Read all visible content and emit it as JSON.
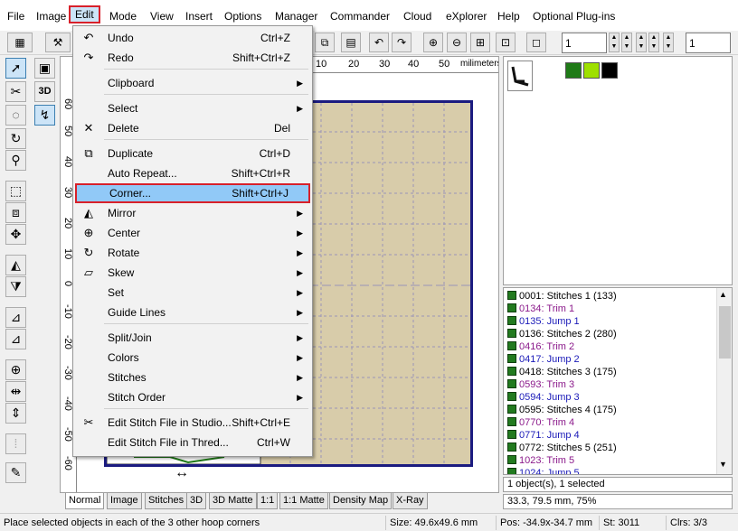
{
  "menubar": {
    "items": [
      "File",
      "Image",
      "Edit",
      "Mode",
      "View",
      "Insert",
      "Options",
      "Manager",
      "Commander",
      "Cloud",
      "eXplorer",
      "Help",
      "Optional Plug-ins"
    ]
  },
  "toolbar": {
    "field1_value": "1",
    "field2_value": "1"
  },
  "ruler": {
    "h_ticks": [
      "10",
      "20",
      "30",
      "40",
      "50"
    ],
    "h_unit": "milimeters",
    "v_ticks": [
      "60",
      "50",
      "40",
      "30",
      "20",
      "10",
      "0",
      "-10",
      "-20",
      "-30",
      "-40",
      "-50",
      "-60"
    ]
  },
  "edit_menu": {
    "items": [
      {
        "label": "Undo",
        "shortcut": "Ctrl+Z",
        "icon": "undo-icon",
        "glyph": "↶"
      },
      {
        "label": "Redo",
        "shortcut": "Shift+Ctrl+Z",
        "icon": "redo-icon",
        "glyph": "↷"
      },
      {
        "label": "Clipboard",
        "submenu": true
      },
      {
        "label": "Select",
        "submenu": true
      },
      {
        "label": "Delete",
        "shortcut": "Del",
        "icon": "delete-icon",
        "glyph": "✕"
      },
      {
        "label": "Duplicate",
        "shortcut": "Ctrl+D",
        "icon": "duplicate-icon",
        "glyph": "⧉"
      },
      {
        "label": "Auto Repeat...",
        "shortcut": "Shift+Ctrl+R"
      },
      {
        "label": "Corner...",
        "shortcut": "Shift+Ctrl+J",
        "highlighted": true
      },
      {
        "label": "Mirror",
        "submenu": true,
        "icon": "mirror-icon",
        "glyph": "◭"
      },
      {
        "label": "Center",
        "submenu": true,
        "icon": "center-icon",
        "glyph": "⊕"
      },
      {
        "label": "Rotate",
        "submenu": true,
        "icon": "rotate-icon",
        "glyph": "↻"
      },
      {
        "label": "Skew",
        "submenu": true,
        "icon": "skew-icon",
        "glyph": "▱"
      },
      {
        "label": "Set",
        "submenu": true
      },
      {
        "label": "Guide Lines",
        "submenu": true
      },
      {
        "label": "Split/Join",
        "submenu": true
      },
      {
        "label": "Colors",
        "submenu": true
      },
      {
        "label": "Stitches",
        "submenu": true
      },
      {
        "label": "Stitch Order",
        "submenu": true
      },
      {
        "label": "Edit Stitch File in Studio...",
        "shortcut": "Shift+Ctrl+E",
        "icon": "studio-icon",
        "glyph": "✂"
      },
      {
        "label": "Edit Stitch File in Thred...",
        "shortcut": "Ctrl+W"
      }
    ]
  },
  "colors": {
    "swatch1": "#1f7a17",
    "swatch2": "#9ee000",
    "swatch3": "#000000"
  },
  "object_list": [
    {
      "text": "0001:  Stitches 1 (133)",
      "color": "#000000"
    },
    {
      "text": "0134:  Trim 1",
      "color": "#8b1a8b"
    },
    {
      "text": "0135:  Jump 1",
      "color": "#1a1ab8"
    },
    {
      "text": "0136:  Stitches 2 (280)",
      "color": "#000000"
    },
    {
      "text": "0416:  Trim 2",
      "color": "#8b1a8b"
    },
    {
      "text": "0417:  Jump 2",
      "color": "#1a1ab8"
    },
    {
      "text": "0418:  Stitches 3 (175)",
      "color": "#000000"
    },
    {
      "text": "0593:  Trim 3",
      "color": "#8b1a8b"
    },
    {
      "text": "0594:  Jump 3",
      "color": "#1a1ab8"
    },
    {
      "text": "0595:  Stitches 4 (175)",
      "color": "#000000"
    },
    {
      "text": "0770:  Trim 4",
      "color": "#8b1a8b"
    },
    {
      "text": "0771:  Jump 4",
      "color": "#1a1ab8"
    },
    {
      "text": "0772:  Stitches 5 (251)",
      "color": "#000000"
    },
    {
      "text": "1023:  Trim 5",
      "color": "#8b1a8b"
    },
    {
      "text": "1024:  Jump 5",
      "color": "#1a1ab8"
    }
  ],
  "info": {
    "selection": "1 object(s), 1 selected",
    "coords": "33.3, 79.5 mm, 75%"
  },
  "tabs": [
    "Normal",
    "Image",
    "Stitches",
    "3D",
    "3D Matte",
    "1:1",
    "1:1 Matte",
    "Density Map",
    "X-Ray"
  ],
  "status": {
    "message": "Place selected objects in each of the 3 other hoop corners",
    "size": "Size: 49.6x49.6 mm",
    "pos": "Pos: -34.9x-34.7 mm",
    "st": "St: 3011",
    "clrs": "Clrs: 3/3"
  }
}
